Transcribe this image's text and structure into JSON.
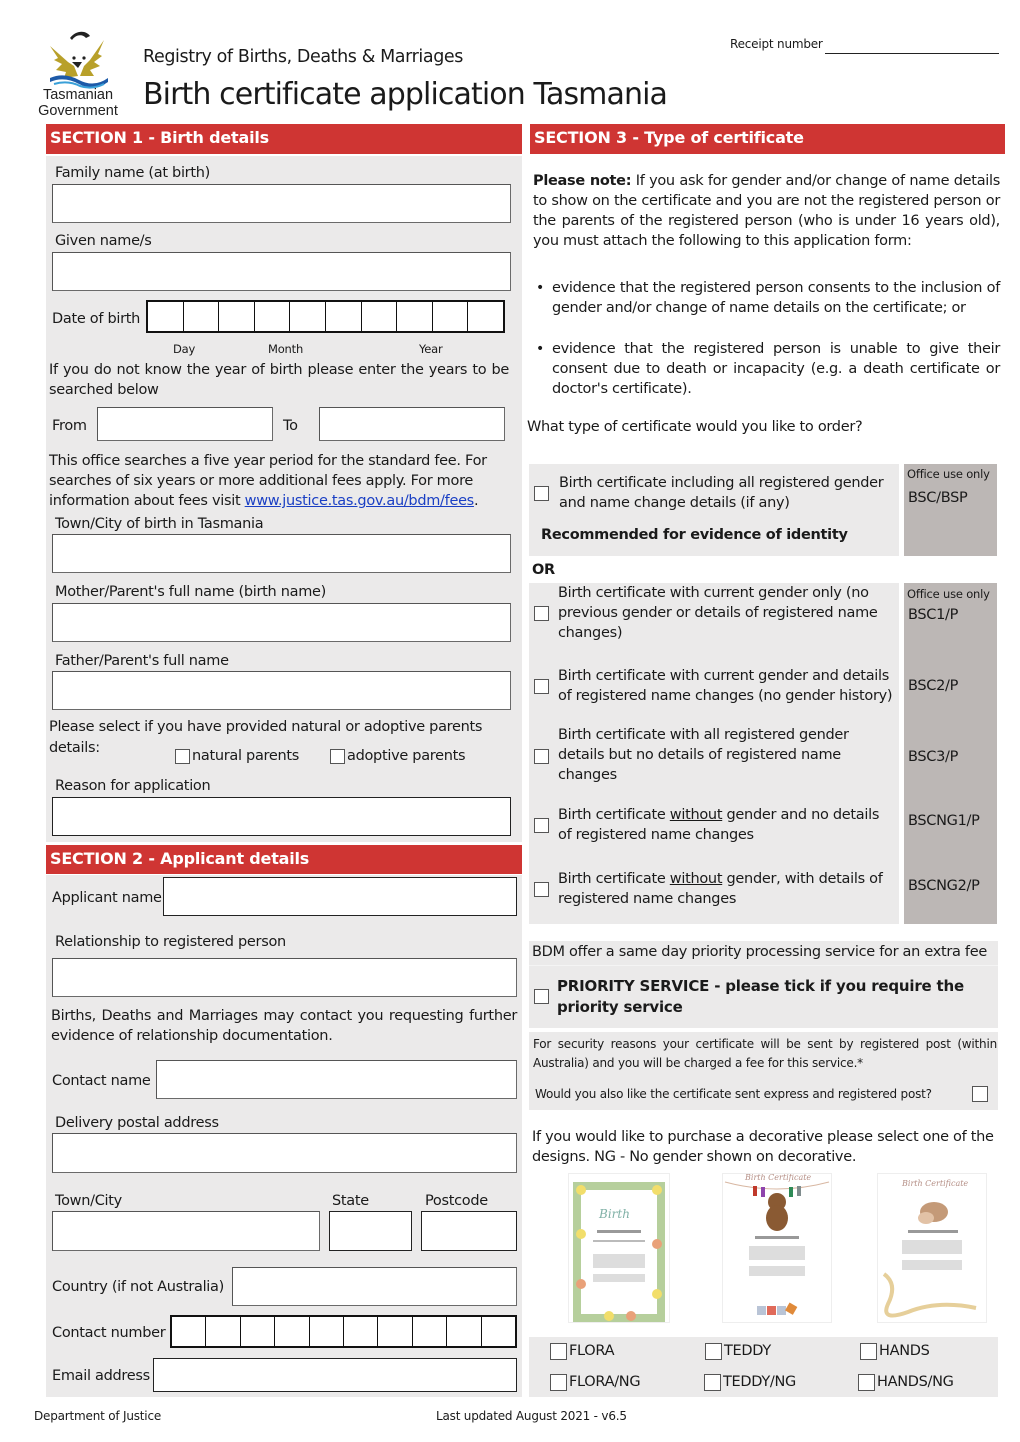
{
  "header": {
    "logo_text_line1": "Tasmanian",
    "logo_text_line2": "Government",
    "registry": "Registry of Births, Deaths & Marriages",
    "title": "Birth certificate application Tasmania",
    "receipt_label": "Receipt number"
  },
  "section1": {
    "title": "SECTION 1 - Birth details",
    "family_name_label": "Family name (at birth)",
    "given_names_label": "Given name/s",
    "dob_label": "Date of birth",
    "dob_day": "Day",
    "dob_month": "Month",
    "dob_year": "Year",
    "unknown_year_text": "If you do not know the year of birth please enter the years to be searched below",
    "from_label": "From",
    "to_label": "To",
    "fee_text_pre": "This office searches a five year period for the standard fee.  For searches of six years or more additional fees apply.  For more information about fees visit ",
    "fee_link": "www.justice.tas.gov.au/bdm/fees",
    "fee_text_post": ".",
    "town_label": "Town/City of birth in Tasmania",
    "mother_label": "Mother/Parent's full name (birth name)",
    "father_label": "Father/Parent's full name",
    "parents_select_text_line1": "Please select if you have provided natural or adoptive parents",
    "parents_select_text_line2": "details:",
    "natural_parents": "natural parents",
    "adoptive_parents": "adoptive parents",
    "reason_label": "Reason for application"
  },
  "section2": {
    "title": "SECTION 2 - Applicant details",
    "applicant_name_label": "Applicant name",
    "relationship_label": "Relationship to registered person",
    "contact_note": "Births, Deaths and Marriages may contact you requesting further evidence of relationship documentation.",
    "contact_name_label": "Contact name",
    "delivery_address_label": "Delivery postal address",
    "town_city_label": "Town/City",
    "state_label": "State",
    "postcode_label": "Postcode",
    "country_label": "Country (if not Australia)",
    "contact_number_label": "Contact number",
    "email_label": "Email address"
  },
  "section3": {
    "title": "SECTION 3 - Type of certificate",
    "note_bold": "Please note:",
    "note_text": " If you ask for gender and/or change of name details to show on the certificate and you are not the registered person or the parents of the registered person (who is under 16 years old), you must attach the following to this application form:",
    "bullets": [
      "evidence that the registered person consents to the inclusion of gender and/or change of name details on the certificate; or",
      "evidence that the registered person is unable to give their consent due to death or incapacity (e.g. a death certificate or doctor's certificate)."
    ],
    "question": "What type of certificate would you like to order?",
    "office_use_label": "Office use only",
    "option1": {
      "text": "Birth certificate including all registered gender and name change details (if any)",
      "recommended": "Recommended for evidence of identity",
      "code": "BSC/BSP"
    },
    "or_label": "OR",
    "options": [
      {
        "text": "Birth certificate with current gender only (no previous gender or details of registered name changes)",
        "code": "BSC1/P"
      },
      {
        "text": "Birth certificate with current gender and details of registered name changes (no gender history)",
        "code": "BSC2/P"
      },
      {
        "text": "Birth certificate with all registered gender details but no details of registered name changes",
        "code": "BSC3/P"
      },
      {
        "text_pre": "Birth certificate ",
        "text_u": "without",
        "text_post": " gender and no details of registered name changes",
        "code": "BSCNG1/P"
      },
      {
        "text_pre": "Birth certificate ",
        "text_u": "without",
        "text_post": " gender, with details of registered name changes",
        "code": "BSCNG2/P"
      }
    ],
    "priority_intro": "BDM offer a same day priority processing service for an extra fee",
    "priority_label": "PRIORITY SERVICE - please tick if you require the priority service",
    "security_text": "For security reasons your certificate will be sent by registered post (within Australia) and you will be charged a fee for this service.*",
    "express_question": "Would you also like the certificate sent express and registered post?",
    "decorative_text": "If you would like to purchase a decorative please select one of the designs.  NG - No gender shown on decorative.",
    "designs": [
      {
        "name": "Flora",
        "image": "flora-certificate"
      },
      {
        "name": "Teddy",
        "image": "teddy-certificate"
      },
      {
        "name": "Hands",
        "image": "hands-certificate"
      }
    ],
    "decorative_options": [
      "FLORA",
      "TEDDY",
      "HANDS",
      "FLORA/NG",
      "TEDDY/NG",
      "HANDS/NG"
    ]
  },
  "footer": {
    "department": "Department of Justice",
    "updated": "Last updated August 2021 - v6.5"
  }
}
